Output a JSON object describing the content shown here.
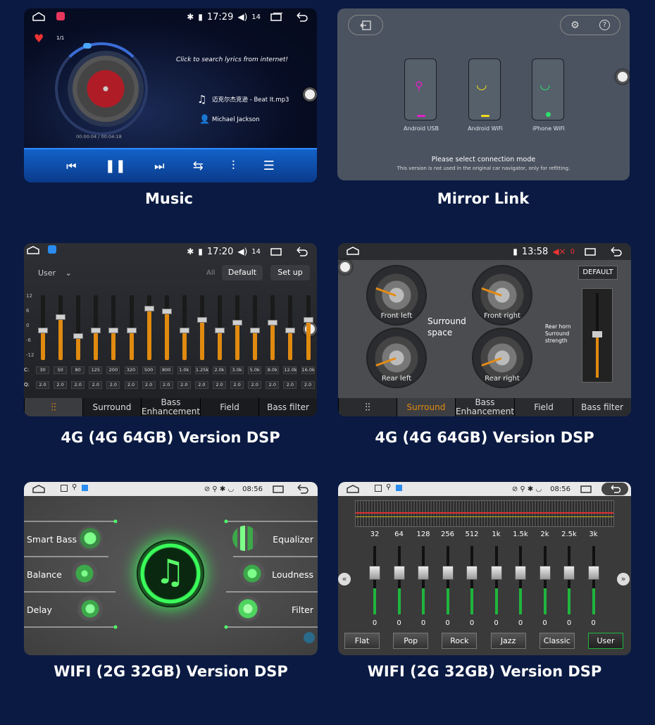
{
  "captions": {
    "music": "Music",
    "mirror": "Mirror Link",
    "dsp4g_a": "4G (4G 64GB) Version DSP",
    "dsp4g_b": "4G (4G 64GB) Version DSP",
    "dspwifi_a": "WIFI (2G 32GB) Version DSP",
    "dspwifi_b": "WIFI (2G 32GB) Version DSP"
  },
  "music": {
    "time": "17:29",
    "volume": "14",
    "track_index": "1/1",
    "lyrics_prompt": "Click to search lyrics from internet!",
    "song": "迈克尔杰克逊 - Beat It.mp3",
    "artist": "Michael Jackson",
    "progress": "00:00:04 / 00:04:18",
    "progress_fraction": 0.015
  },
  "mirror": {
    "modes": [
      {
        "label": "Android USB",
        "color": "#e020c8"
      },
      {
        "label": "Android WiFi",
        "color": "#f2dc1a"
      },
      {
        "label": "iPhone WiFi",
        "color": "#2ee06a"
      }
    ],
    "prompt": "Please select connection mode",
    "note": "This version is not used in the original car navigator, only for refitting."
  },
  "eq4g": {
    "time": "17:20",
    "volume": "14",
    "preset": "User",
    "tab_all": "All",
    "tab_default": "Default",
    "setup": "Set up",
    "y_ticks": [
      "12",
      "6",
      "0",
      "-6",
      "-12"
    ],
    "row_label_c": "C:",
    "row_label_q": "Q:",
    "frequencies": [
      "30",
      "50",
      "80",
      "125",
      "200",
      "320",
      "500",
      "800",
      "1.0k",
      "1.25k",
      "2.0k",
      "3.0k",
      "5.0k",
      "8.0k",
      "12.0k",
      "16.0k"
    ],
    "q_values": [
      "2.0",
      "2.0",
      "2.0",
      "2.0",
      "2.0",
      "2.0",
      "2.0",
      "2.0",
      "2.0",
      "2.0",
      "2.0",
      "2.0",
      "2.0",
      "2.0",
      "2.0",
      "2.0"
    ],
    "levels": [
      0,
      5,
      -2,
      0,
      0,
      0,
      8,
      7,
      0,
      4,
      0,
      3,
      0,
      3,
      0,
      4
    ],
    "tabs": [
      "Surround",
      "Bass\nEnhancement",
      "Field",
      "Bass filter"
    ]
  },
  "surround": {
    "time": "13:58",
    "volume": "0",
    "default": "DEFAULT",
    "front_left": "Front left",
    "front_right": "Front right",
    "rear_left": "Rear left",
    "rear_right": "Rear right",
    "center": "Surround\nspace",
    "rear_horn": "Rear horn\nSurround\nstrength",
    "tabs": [
      "Surround",
      "Bass\nEnhancement",
      "Field",
      "Bass filter"
    ],
    "active_tab": "Surround"
  },
  "dspwifi": {
    "time": "08:56",
    "items_left": [
      "Smart Bass",
      "Balance",
      "Delay"
    ],
    "items_right": [
      "Equalizer",
      "Loudness",
      "Filter"
    ]
  },
  "eqwifi": {
    "time": "08:56",
    "bands": [
      "32",
      "64",
      "128",
      "256",
      "512",
      "1k",
      "1.5k",
      "2k",
      "2.5k",
      "3k"
    ],
    "values": [
      "0",
      "0",
      "0",
      "0",
      "0",
      "0",
      "0",
      "0",
      "0",
      "0"
    ],
    "presets": [
      "Flat",
      "Pop",
      "Rock",
      "Jazz",
      "Classic",
      "User"
    ],
    "active_preset": "User"
  }
}
